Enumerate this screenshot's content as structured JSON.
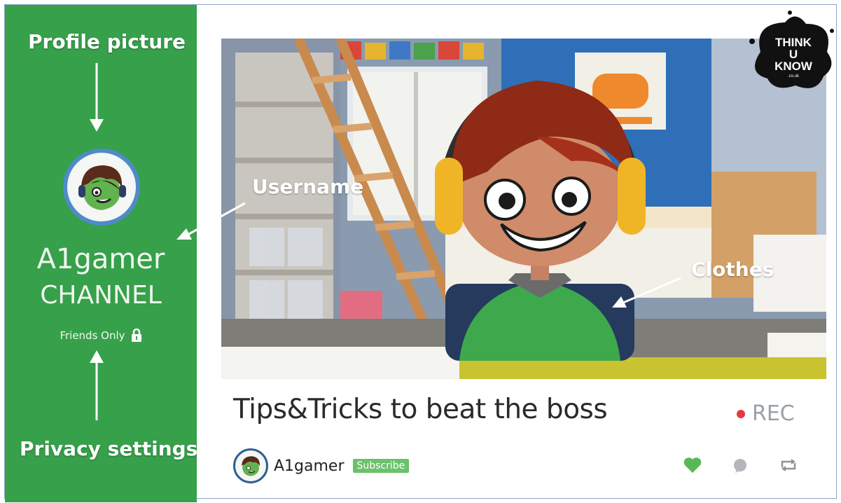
{
  "sidebar": {
    "callouts": {
      "profile_picture": "Profile picture",
      "privacy_settings": "Privacy settings"
    },
    "channel_line1": "A1gamer",
    "channel_line2": "CHANNEL",
    "privacy_label": "Friends Only",
    "privacy_icon": "lock-icon"
  },
  "video": {
    "callouts": {
      "username": "Username",
      "clothes": "Clothes"
    },
    "title": "Tips&Tricks to beat the boss",
    "status": "REC",
    "owner": "A1gamer",
    "subscribe_label": "Subscribe",
    "action_icons": [
      "heart-icon",
      "comment-icon",
      "repost-icon"
    ]
  },
  "logo": {
    "line1": "THINK",
    "line2": "U",
    "line3": "KNOW",
    "line4": ".co.uk"
  },
  "colors": {
    "sidebar_green": "#36a04a",
    "accent_blue": "#4f8bc9",
    "rec_red": "#e8373f",
    "heart_green": "#58b857",
    "subscribe_green": "#6bc26a"
  }
}
